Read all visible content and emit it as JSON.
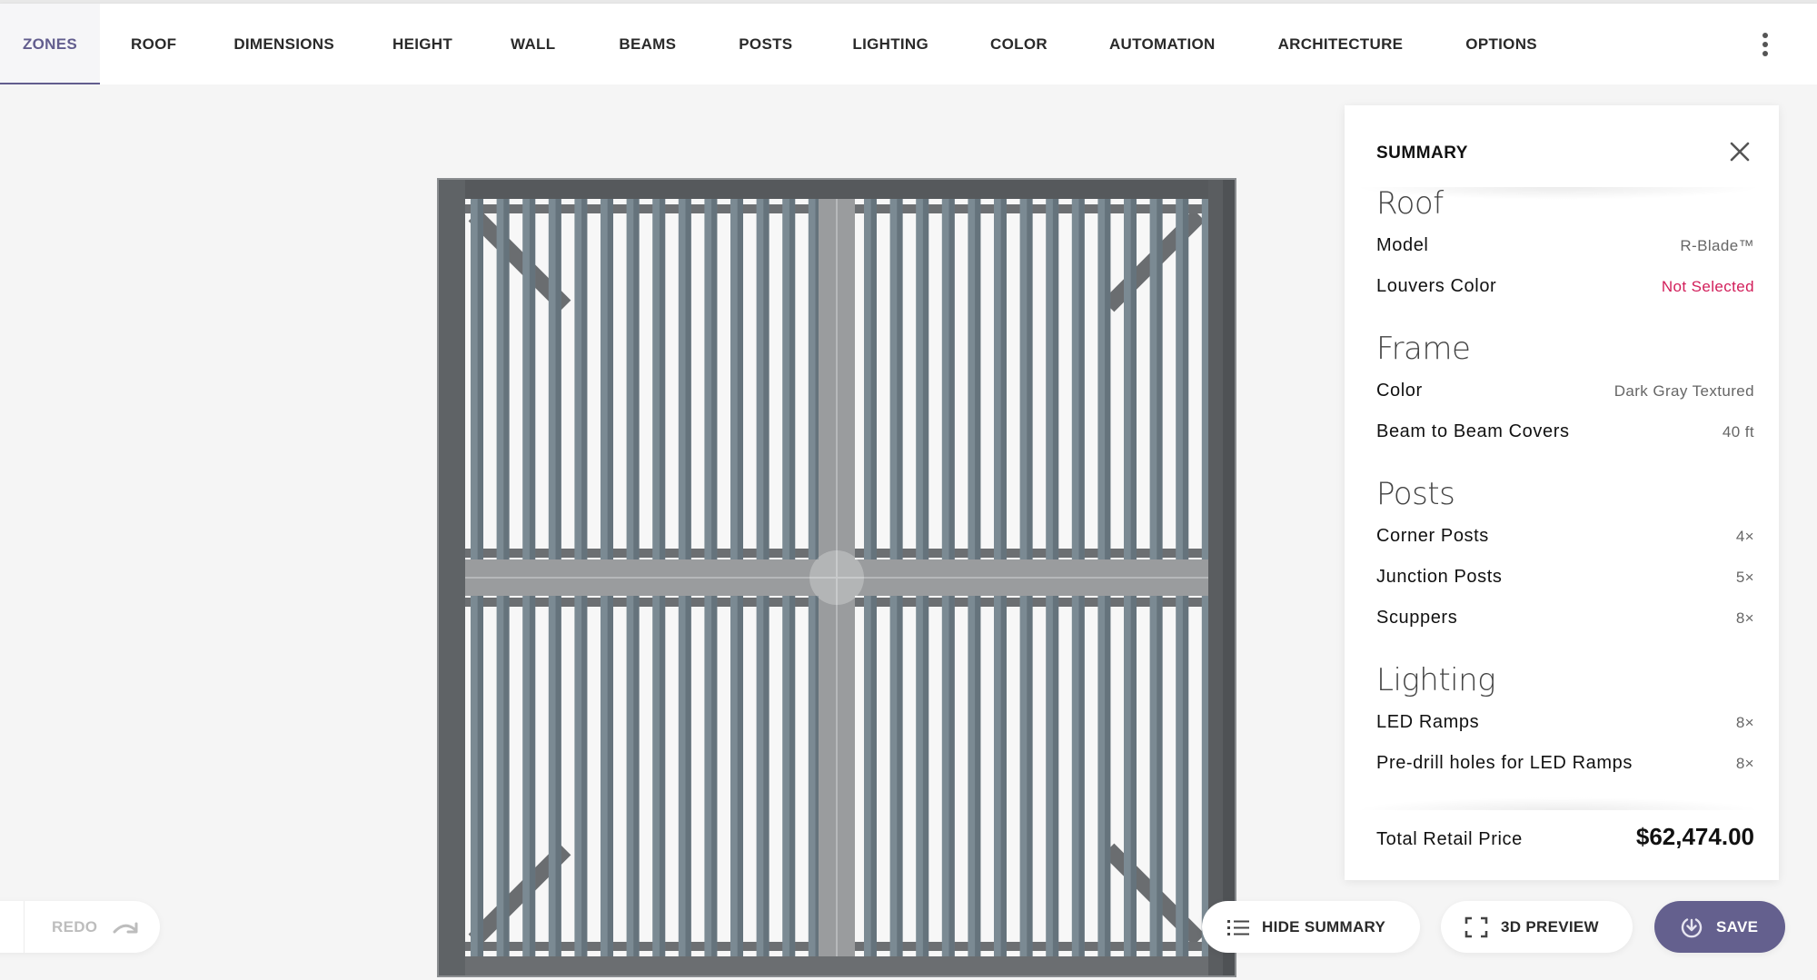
{
  "tabs": [
    {
      "label": "ZONES",
      "active": true
    },
    {
      "label": "ROOF"
    },
    {
      "label": "DIMENSIONS"
    },
    {
      "label": "HEIGHT"
    },
    {
      "label": "WALL"
    },
    {
      "label": "BEAMS"
    },
    {
      "label": "POSTS"
    },
    {
      "label": "LIGHTING"
    },
    {
      "label": "COLOR"
    },
    {
      "label": "AUTOMATION"
    },
    {
      "label": "ARCHITECTURE"
    },
    {
      "label": "OPTIONS"
    }
  ],
  "menu_icon": "kebab-vertical-icon",
  "viewer": {
    "view": "top-down pergola plan",
    "zones": 4,
    "louvers_per_zone_row": 14,
    "colors": {
      "frame": "#5f6366",
      "louver": "#7b8a93",
      "beam": "#9a9c9e"
    }
  },
  "summary": {
    "title": "SUMMARY",
    "close_icon": "close-icon",
    "sections": [
      {
        "title": "Roof",
        "rows": [
          {
            "label": "Model",
            "value": "R-Blade™"
          },
          {
            "label": "Louvers Color",
            "value": "Not Selected",
            "warning": true
          }
        ]
      },
      {
        "title": "Frame",
        "rows": [
          {
            "label": "Color",
            "value": "Dark Gray Textured"
          },
          {
            "label": "Beam to Beam Covers",
            "value": "40 ft"
          }
        ]
      },
      {
        "title": "Posts",
        "rows": [
          {
            "label": "Corner Posts",
            "value": "4×"
          },
          {
            "label": "Junction Posts",
            "value": "5×"
          },
          {
            "label": "Scuppers",
            "value": "8×"
          }
        ]
      },
      {
        "title": "Lighting",
        "rows": [
          {
            "label": "LED Ramps",
            "value": "8×"
          },
          {
            "label": "Pre-drill holes for LED Ramps",
            "value": "8×"
          }
        ]
      }
    ],
    "total_label": "Total Retail Price",
    "total_value": "$62,474.00"
  },
  "toolbar": {
    "redo_label": "REDO",
    "hide_summary_label": "HIDE SUMMARY",
    "preview_label": "3D PREVIEW",
    "save_label": "SAVE"
  },
  "colors": {
    "accent": "#64608e",
    "warning": "#d21e5a"
  }
}
